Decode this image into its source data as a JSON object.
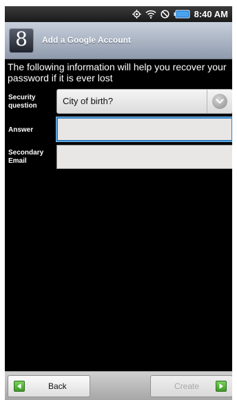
{
  "status_bar": {
    "time": "8:40 AM",
    "icons": [
      "gps-icon",
      "wifi-icon",
      "do-not-disturb-icon",
      "battery-icon"
    ]
  },
  "header": {
    "app_icon_letter": "8",
    "title": "Add a Google Account"
  },
  "intro_text": "The following information will help you recover your password if it is ever lost",
  "form": {
    "security_question": {
      "label_line1": "Security",
      "label_line2": "question",
      "value": "City of birth?"
    },
    "answer": {
      "label": "Answer",
      "value": ""
    },
    "secondary_email": {
      "label_line1": "Secondary",
      "label_line2": "Email",
      "value": ""
    }
  },
  "footer": {
    "back_label": "Back",
    "create_label": "Create"
  },
  "colors": {
    "focus_border": "#2f7fc1",
    "button_arrow": "#4fae33"
  }
}
